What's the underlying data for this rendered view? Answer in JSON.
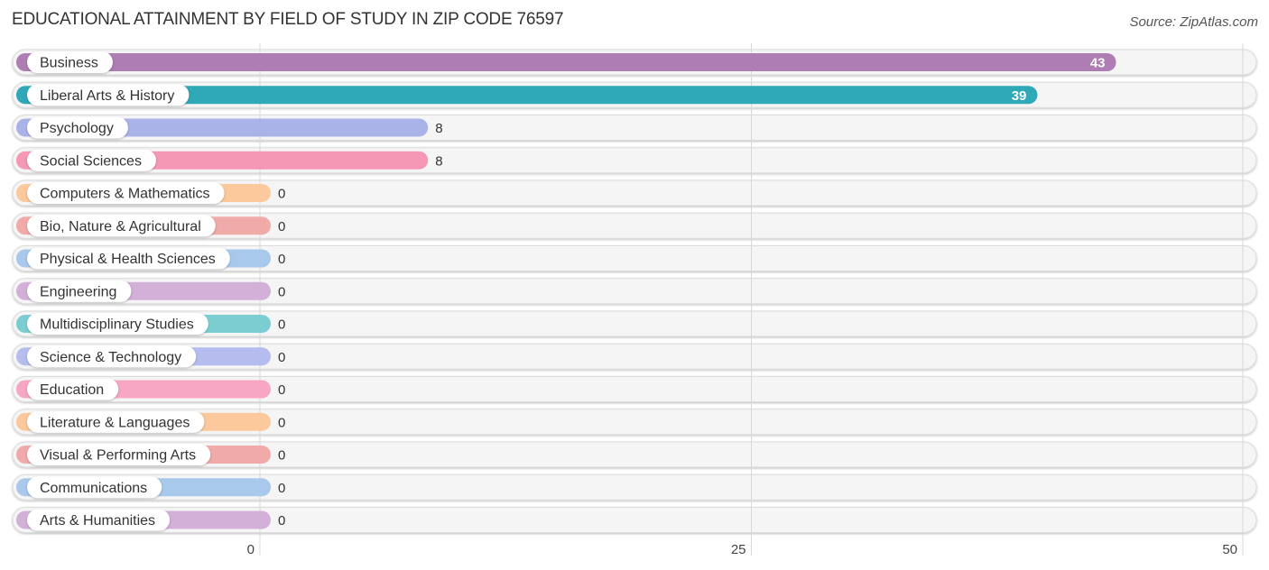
{
  "header": {
    "title": "EDUCATIONAL ATTAINMENT BY FIELD OF STUDY IN ZIP CODE 76597",
    "source": "Source: ZipAtlas.com"
  },
  "chart_data": {
    "type": "bar",
    "orientation": "horizontal",
    "title": "EDUCATIONAL ATTAINMENT BY FIELD OF STUDY IN ZIP CODE 76597",
    "xlabel": "",
    "ylabel": "",
    "xlim": [
      0,
      50
    ],
    "xticks": [
      0,
      25,
      50
    ],
    "grid": true,
    "categories": [
      "Business",
      "Liberal Arts & History",
      "Psychology",
      "Social Sciences",
      "Computers & Mathematics",
      "Bio, Nature & Agricultural",
      "Physical & Health Sciences",
      "Engineering",
      "Multidisciplinary Studies",
      "Science & Technology",
      "Education",
      "Literature & Languages",
      "Visual & Performing Arts",
      "Communications",
      "Arts & Humanities"
    ],
    "values": [
      43,
      39,
      8,
      8,
      0,
      0,
      0,
      0,
      0,
      0,
      0,
      0,
      0,
      0,
      0
    ],
    "colors": [
      "#ad7db3",
      "#2fa8b8",
      "#aab3e8",
      "#f598b5",
      "#fbc99c",
      "#f0aaa8",
      "#a8c8ec",
      "#d2b0d8",
      "#7ccdd2",
      "#b4bdee",
      "#f7a6c4",
      "#fbc99c",
      "#f0aaa8",
      "#a8c8ec",
      "#d2b0d8"
    ]
  }
}
